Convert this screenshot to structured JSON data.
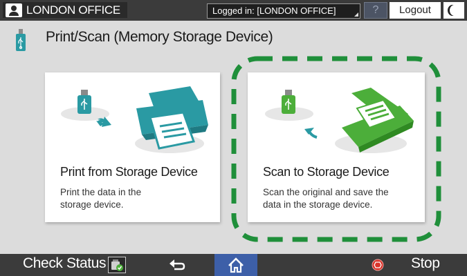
{
  "header": {
    "user_label": "LONDON OFFICE",
    "login_status": "Logged in: [LONDON OFFICE]",
    "help_label": "?",
    "logout_label": "Logout"
  },
  "page": {
    "title": "Print/Scan (Memory Storage Device)"
  },
  "cards": [
    {
      "title": "Print from Storage Device",
      "description": "Print the data in the storage device."
    },
    {
      "title": "Scan to Storage Device",
      "description": "Scan the original and save the data in the storage device."
    }
  ],
  "footer": {
    "check_status_label": "Check Status",
    "stop_label": "Stop"
  },
  "colors": {
    "printer_teal": "#2a9aa3",
    "scanner_green": "#4cae3a",
    "highlight_dash": "#1f8f3a",
    "home_blue": "#3d5fa8",
    "stop_red": "#d9342b"
  }
}
